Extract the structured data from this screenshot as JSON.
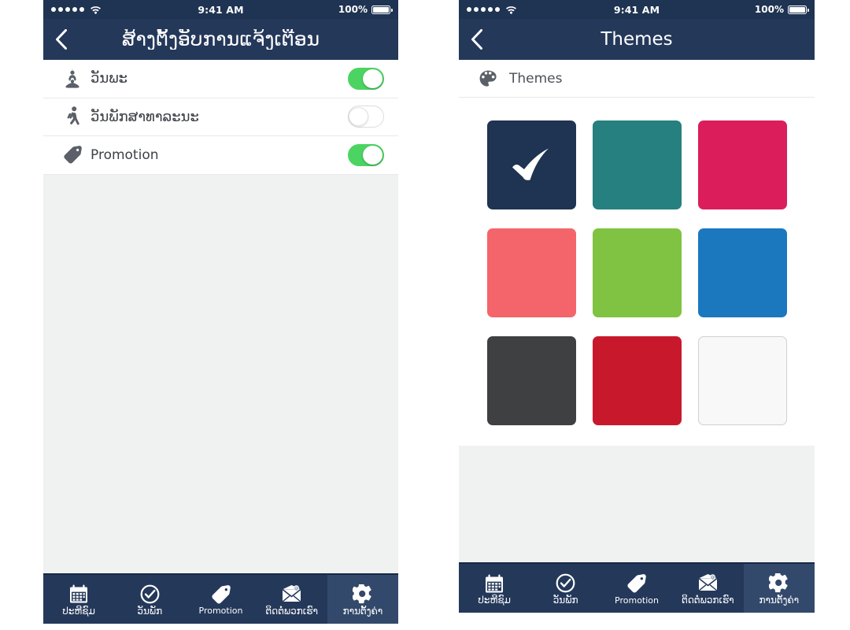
{
  "status_bar": {
    "signal_dots": 5,
    "wifi_icon": "wifi-icon",
    "time": "9:41 AM",
    "battery_percent": "100%"
  },
  "colors": {
    "statusbar_bg": "#1f3352",
    "navbar_bg": "#24385a",
    "tabbar_bg": "#24385a",
    "tab_active_bg": "#33496b",
    "switch_on": "#4cd462",
    "filler_grey": "#f0f1f1",
    "label_text": "#3d4148"
  },
  "left_screen": {
    "nav": {
      "back_icon": "chevron-left-icon",
      "title": "ສ້າງຕັ້ງອັບການແຈ້ງເຕືອນ"
    },
    "rows": [
      {
        "icon": "buddha-icon",
        "label": "ວັນພະ",
        "switch": "on"
      },
      {
        "icon": "walking-icon",
        "label": "ວັນພັກສາທາລະນະ",
        "switch": "off"
      },
      {
        "icon": "tag-icon",
        "label": "Promotion",
        "switch": "on"
      }
    ]
  },
  "right_screen": {
    "nav": {
      "back_icon": "chevron-left-icon",
      "title": "Themes"
    },
    "section": {
      "icon": "palette-icon",
      "label": "Themes"
    },
    "swatches": [
      [
        {
          "name": "navy",
          "color": "#1f3352",
          "selected": true,
          "bordered": false
        },
        {
          "name": "teal",
          "color": "#25807f",
          "selected": false,
          "bordered": false
        },
        {
          "name": "pink",
          "color": "#db1e5b",
          "selected": false,
          "bordered": false
        }
      ],
      [
        {
          "name": "salmon",
          "color": "#f4656b",
          "selected": false,
          "bordered": false
        },
        {
          "name": "green",
          "color": "#80c342",
          "selected": false,
          "bordered": false
        },
        {
          "name": "blue",
          "color": "#1b78bf",
          "selected": false,
          "bordered": false
        }
      ],
      [
        {
          "name": "dark",
          "color": "#3e4042",
          "selected": false,
          "bordered": false
        },
        {
          "name": "red",
          "color": "#c8192c",
          "selected": false,
          "bordered": false
        },
        {
          "name": "white",
          "color": "#f8f8f8",
          "selected": false,
          "bordered": true
        }
      ]
    ]
  },
  "tab_bar": {
    "tabs": [
      {
        "icon": "calendar-icon",
        "label": "ປະຫີຊົມ",
        "active": false,
        "lao": true
      },
      {
        "icon": "check-circle-icon",
        "label": "ວັນພັກ",
        "active": false,
        "lao": true
      },
      {
        "icon": "tag-icon",
        "label": "Promotion",
        "active": false,
        "lao": false
      },
      {
        "icon": "mail-at-icon",
        "label": "ຕິດຕໍ່ພວກເຮົາ",
        "active": false,
        "lao": true
      },
      {
        "icon": "gear-icon",
        "label": "ການຕັ້ງຄ່າ",
        "active": true,
        "lao": true
      }
    ]
  }
}
